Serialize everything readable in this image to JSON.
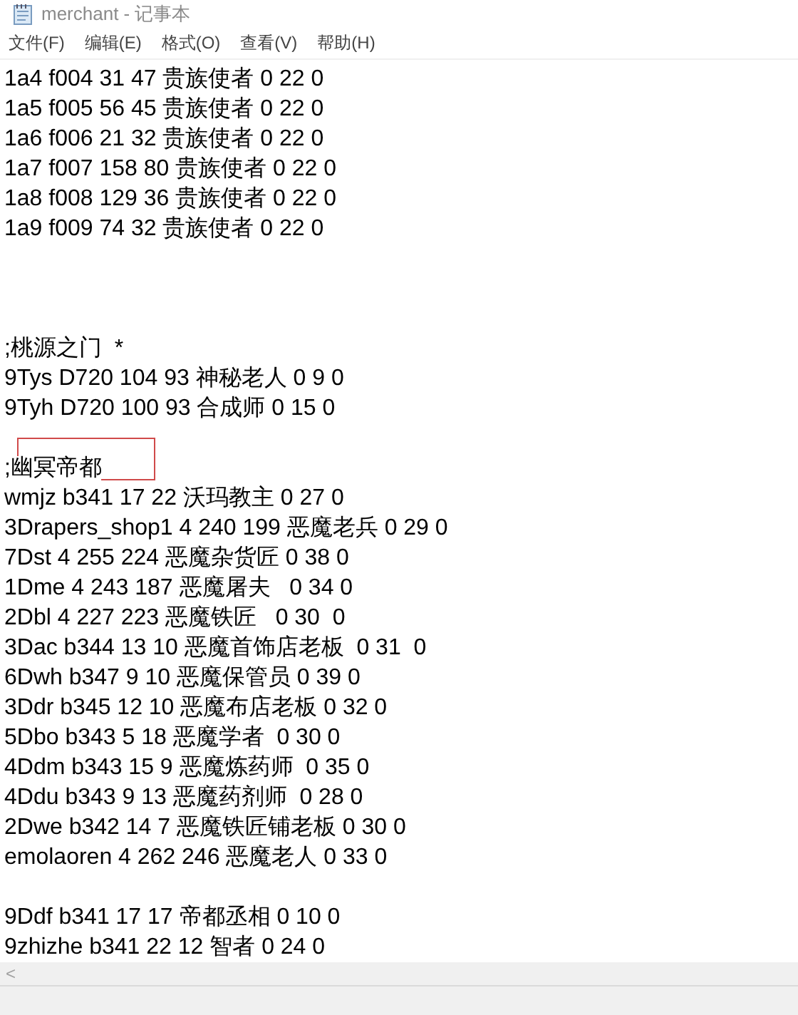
{
  "window": {
    "title": "merchant - 记事本"
  },
  "menu": [
    "文件(F)",
    "编辑(E)",
    "格式(O)",
    "查看(V)",
    "帮助(H)"
  ],
  "lines": [
    {
      "kind": "text",
      "text": "1a4 f004 31 47 贵族使者 0 22 0",
      "marked": false
    },
    {
      "kind": "text",
      "text": "1a5 f005 56 45 贵族使者 0 22 0",
      "marked": false
    },
    {
      "kind": "text",
      "text": "1a6 f006 21 32 贵族使者 0 22 0",
      "marked": false
    },
    {
      "kind": "text",
      "text": "1a7 f007 158 80 贵族使者 0 22 0",
      "marked": false
    },
    {
      "kind": "text",
      "text": "1a8 f008 129 36 贵族使者 0 22 0",
      "marked": false
    },
    {
      "kind": "text",
      "text": "1a9 f009 74 32 贵族使者 0 22 0",
      "marked": false
    },
    {
      "kind": "blank"
    },
    {
      "kind": "blank"
    },
    {
      "kind": "blank"
    },
    {
      "kind": "text",
      "text": ";桃源之门  *",
      "marked": false
    },
    {
      "kind": "text",
      "text": "9Tys D720 104 93 神秘老人 0 9 0",
      "marked": false
    },
    {
      "kind": "text",
      "text": "9Tyh D720 100 93 合成师 0 15 0",
      "marked": false
    },
    {
      "kind": "blank"
    },
    {
      "kind": "text",
      "text": ";幽冥帝都",
      "marked": true
    },
    {
      "kind": "text",
      "text": "wmjz b341 17 22 沃玛教主 0 27 0",
      "marked": false
    },
    {
      "kind": "text",
      "text": "3Drapers_shop1 4 240 199 恶魔老兵 0 29 0",
      "marked": false
    },
    {
      "kind": "text",
      "text": "7Dst 4 255 224 恶魔杂货匠 0 38 0",
      "marked": false
    },
    {
      "kind": "text",
      "text": "1Dme 4 243 187 恶魔屠夫   0 34 0",
      "marked": false
    },
    {
      "kind": "text",
      "text": "2Dbl 4 227 223 恶魔铁匠   0 30  0",
      "marked": false
    },
    {
      "kind": "text",
      "text": "3Dac b344 13 10 恶魔首饰店老板  0 31  0",
      "marked": false
    },
    {
      "kind": "text",
      "text": "6Dwh b347 9 10 恶魔保管员 0 39 0",
      "marked": false
    },
    {
      "kind": "text",
      "text": "3Ddr b345 12 10 恶魔布店老板 0 32 0",
      "marked": false
    },
    {
      "kind": "text",
      "text": "5Dbo b343 5 18 恶魔学者  0 30 0",
      "marked": false
    },
    {
      "kind": "text",
      "text": "4Ddm b343 15 9 恶魔炼药师  0 35 0",
      "marked": false
    },
    {
      "kind": "text",
      "text": "4Ddu b343 9 13 恶魔药剂师  0 28 0",
      "marked": false
    },
    {
      "kind": "text",
      "text": "2Dwe b342 14 7 恶魔铁匠铺老板 0 30 0",
      "marked": false
    },
    {
      "kind": "text",
      "text": "emolaoren 4 262 246 恶魔老人 0 33 0",
      "marked": false
    },
    {
      "kind": "blank"
    },
    {
      "kind": "text",
      "text": "9Ddf b341 17 17 帝都丞相 0 10 0",
      "marked": false
    },
    {
      "kind": "text",
      "text": "9zhizhe b341 22 12 智者 0 24 0",
      "marked": false
    }
  ],
  "scrollbar": {
    "left_arrow": "<"
  }
}
